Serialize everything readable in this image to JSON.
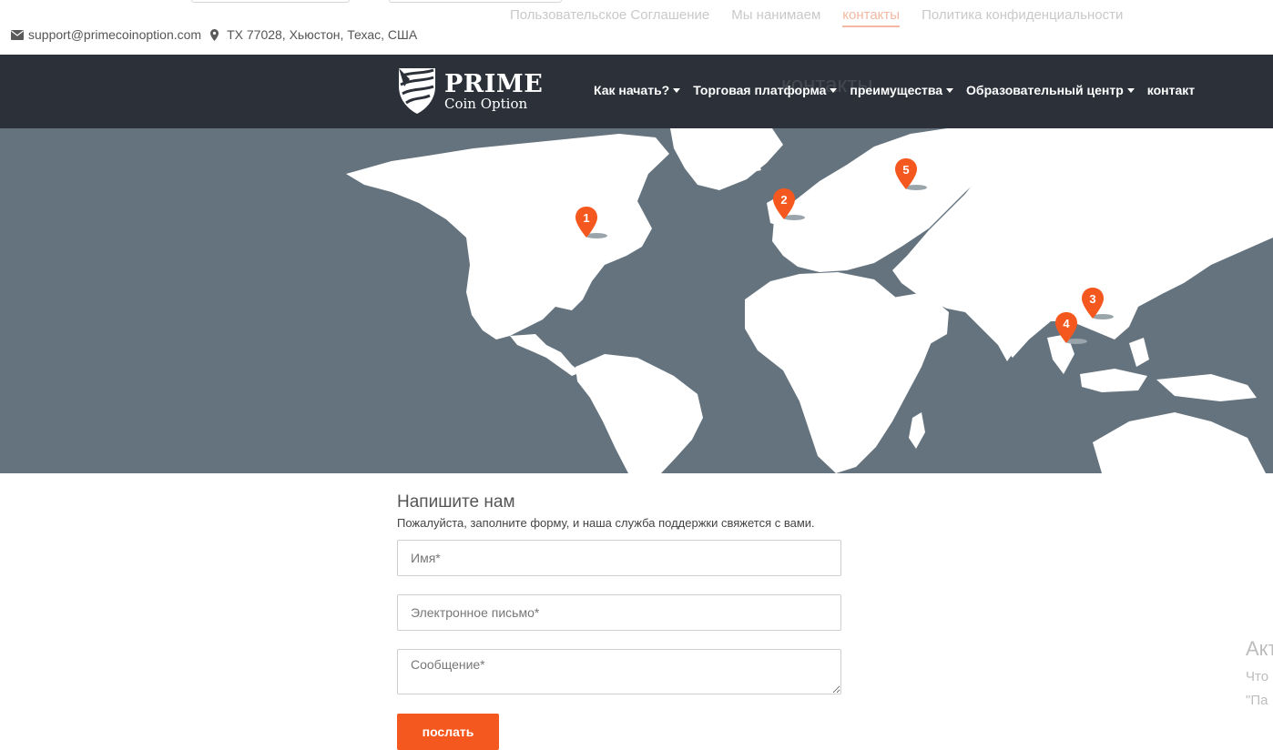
{
  "top_links": [
    "Пользовательское Соглашение",
    "Мы нанимаем",
    "контакты",
    "Политика конфиденциальности"
  ],
  "contact": {
    "email": "support@primecoinoption.com",
    "address": "TX 77028, Хьюстон, Техас, США"
  },
  "brand": {
    "line1": "PRIME",
    "line2": "Coin Option"
  },
  "page_heading": "контакты",
  "nav": [
    {
      "label": "Как начать?",
      "dropdown": true
    },
    {
      "label": "Торговая платформа",
      "dropdown": true
    },
    {
      "label": "преимущества",
      "dropdown": true
    },
    {
      "label": "Образовательный центр",
      "dropdown": true
    },
    {
      "label": "контакт",
      "dropdown": false
    }
  ],
  "map": {
    "ocean_color": "#65737e",
    "land_color": "#ffffff",
    "marker_color": "#f5581e",
    "markers": [
      "1",
      "2",
      "3",
      "4",
      "5"
    ]
  },
  "form": {
    "title": "Напишите нам",
    "subtitle": "Пожалуйста, заполните форму, и наша служба поддержки свяжется с вами.",
    "name_placeholder": "Имя*",
    "email_placeholder": "Электронное письмо*",
    "message_placeholder": "Сообщение*",
    "submit_label": "послать"
  },
  "watermark": {
    "line1": "Акт",
    "line2": "Что",
    "line3": "\"Па"
  },
  "colors": {
    "header_bg": "#2b3039",
    "accent": "#f5581e"
  }
}
